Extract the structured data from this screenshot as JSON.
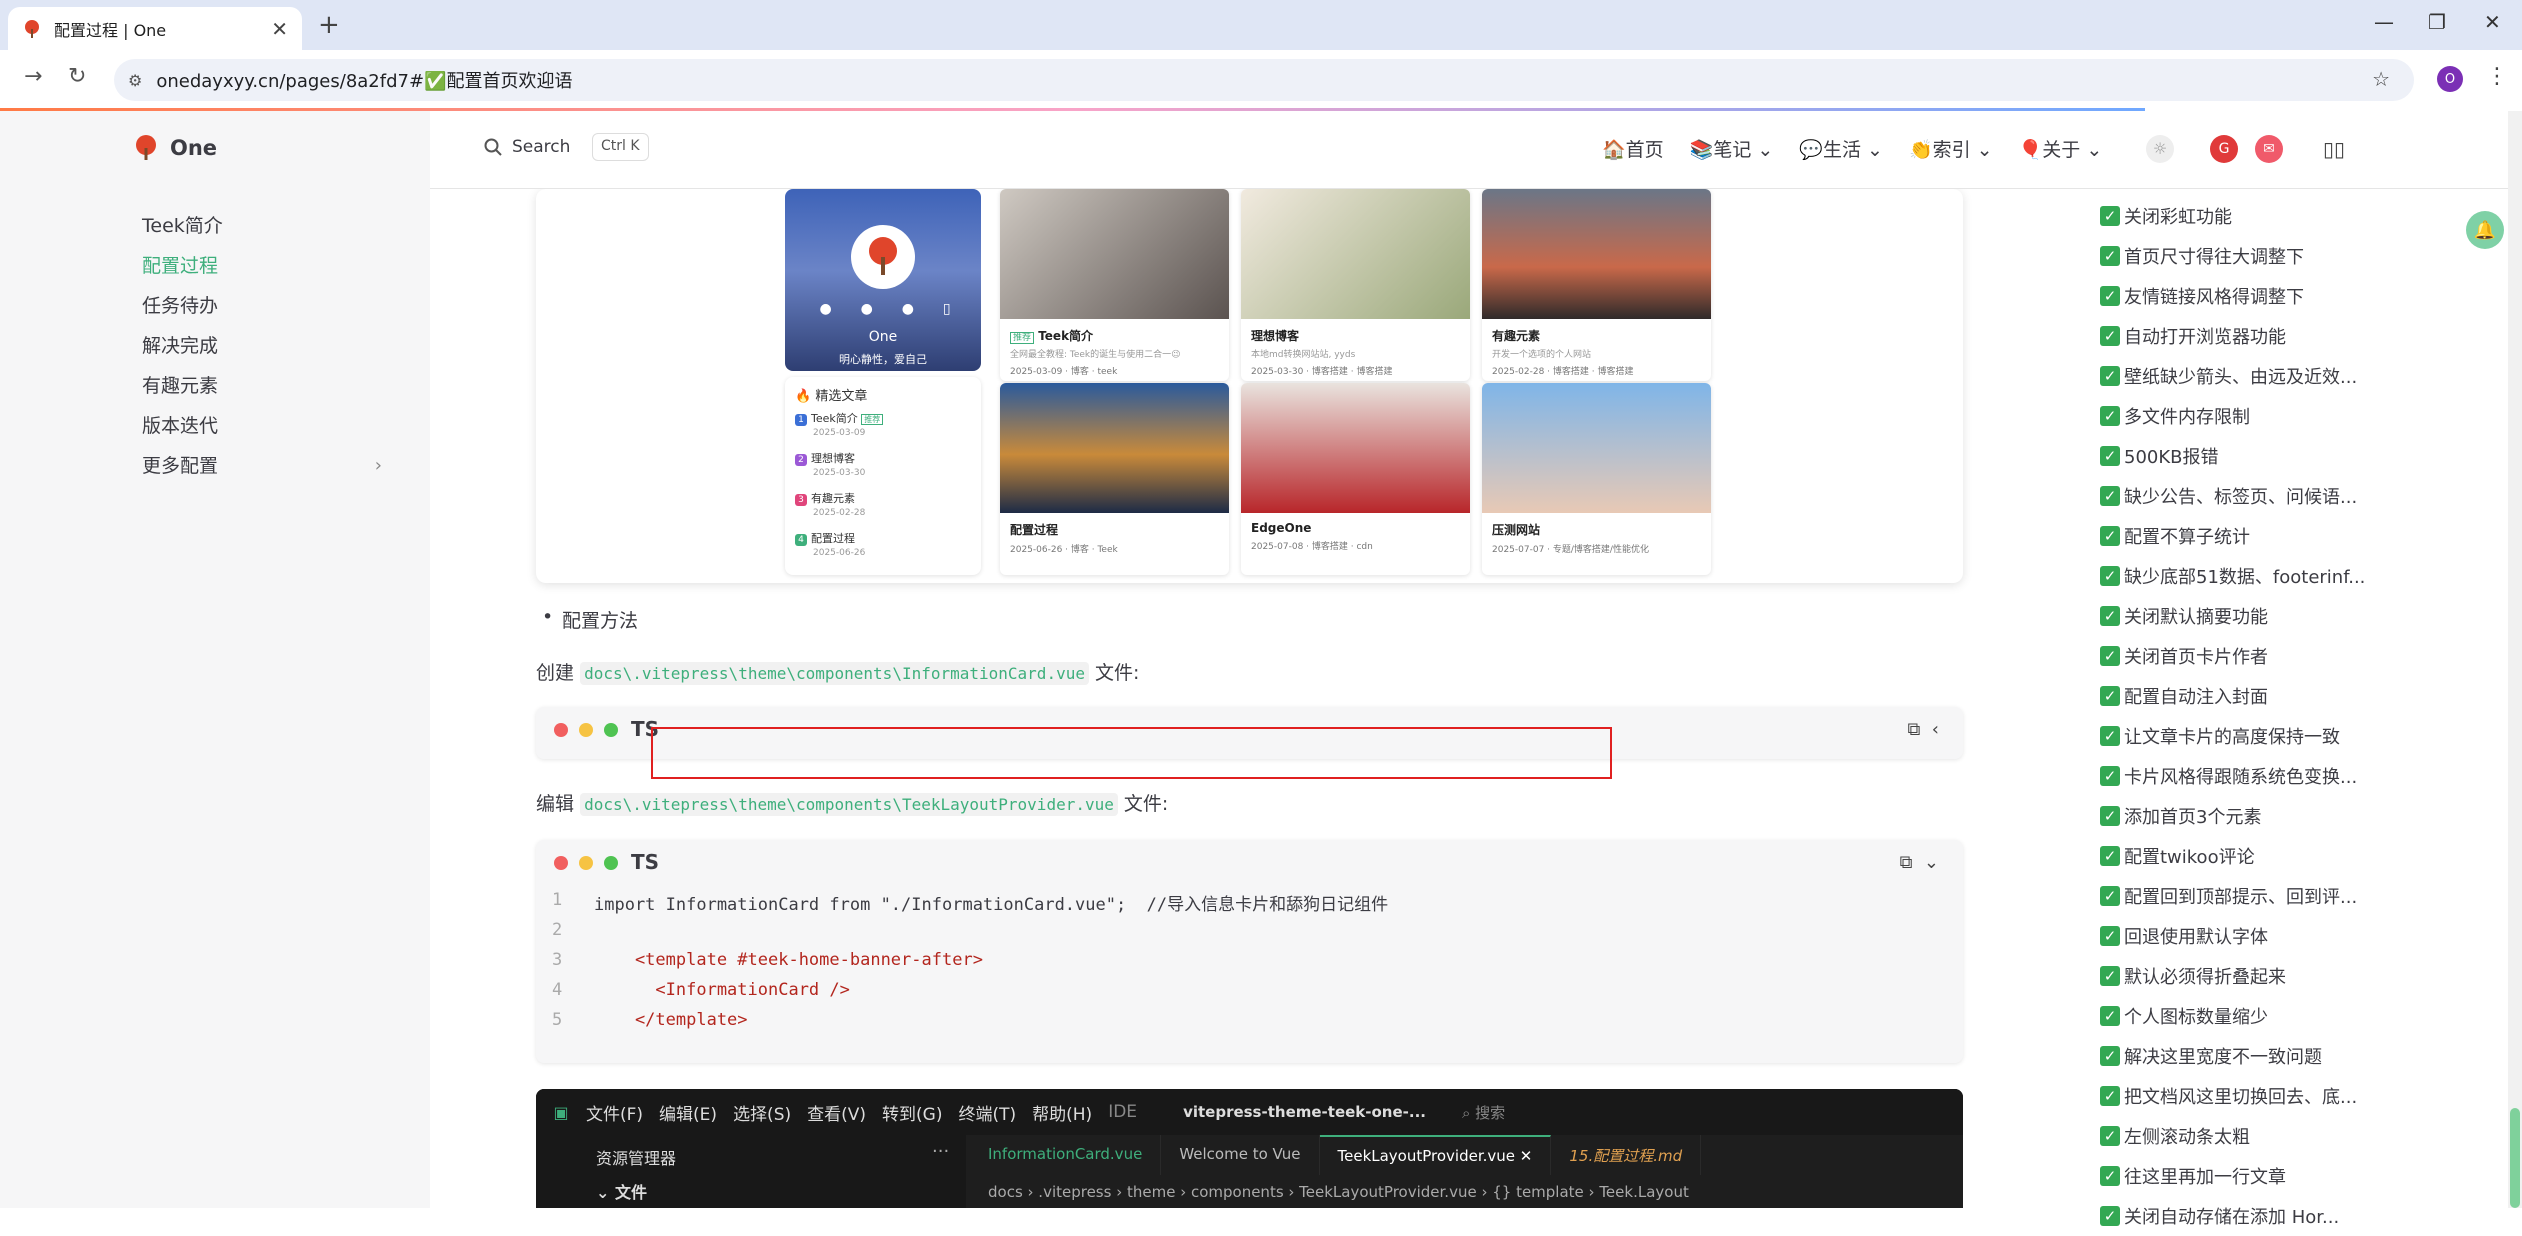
{
  "browser": {
    "tab_title": "配置过程 | One",
    "url": "onedayxyy.cn/pages/8a2fd7#✅配置首页欢迎语",
    "profile_initial": "O"
  },
  "sidebar": {
    "logo_text": "One",
    "items": [
      {
        "label": "Teek简介",
        "active": false
      },
      {
        "label": "配置过程",
        "active": true
      },
      {
        "label": "任务待办",
        "active": false
      },
      {
        "label": "解决完成",
        "active": false
      },
      {
        "label": "有趣元素",
        "active": false
      },
      {
        "label": "版本迭代",
        "active": false
      },
      {
        "label": "更多配置",
        "active": false
      }
    ]
  },
  "topnav": {
    "search_label": "Search",
    "shortcut": "Ctrl K",
    "links": [
      "🏠首页",
      "📚笔记",
      "💬生活",
      "👏索引",
      "🎈关于"
    ]
  },
  "hero": {
    "profile_name": "One",
    "profile_motto": "明心静性，爱自己",
    "featured_header": "🔥 精选文章",
    "featured": [
      {
        "n": "1",
        "title": "Teek简介",
        "tag": "推荐",
        "date": "2025-03-09",
        "color": "#3b6fd6"
      },
      {
        "n": "2",
        "title": "理想博客",
        "date": "2025-03-30",
        "color": "#9b59d6"
      },
      {
        "n": "3",
        "title": "有趣元素",
        "date": "2025-02-28",
        "color": "#e0457b"
      },
      {
        "n": "4",
        "title": "配置过程",
        "date": "2025-06-26",
        "color": "#3eaf7c"
      }
    ],
    "cards": [
      {
        "title": "Teek简介",
        "tag": "推荐",
        "desc": "全网最全教程: Teek的诞生与使用二合一😉",
        "meta": "2025-03-09 · 博客 · teek"
      },
      {
        "title": "理想博客",
        "desc": "本地md转换网站站, yyds",
        "meta": "2025-03-30 · 博客搭建 · 博客搭建"
      },
      {
        "title": "有趣元素",
        "desc": "开发一个选项的个人网站",
        "meta": "2025-02-28 · 博客搭建 · 博客搭建"
      },
      {
        "title": "配置过程",
        "meta": "2025-06-26 · 博客 · Teek"
      },
      {
        "title": "EdgeOne",
        "meta": "2025-07-08 · 博客搭建 · cdn"
      },
      {
        "title": "压测网站",
        "meta": "2025-07-07 · 专题/博客搭建/性能优化"
      }
    ]
  },
  "main": {
    "bullet": "配置方法",
    "create_prefix": "创建",
    "create_path": "docs\\.vitepress\\theme\\components\\InformationCard.vue",
    "create_suffix": "文件:",
    "edit_prefix": "编辑",
    "edit_path": "docs\\.vitepress\\theme\\components\\TeekLayoutProvider.vue",
    "edit_suffix": "文件:",
    "lang1": "TS",
    "lang2": "TS",
    "code": [
      {
        "n": "1",
        "text": "import InformationCard from \"./InformationCard.vue\";  //导入信息卡片和舔狗日记组件"
      },
      {
        "n": "2",
        "text": ""
      },
      {
        "n": "3",
        "text": "    <template #teek-home-banner-after>"
      },
      {
        "n": "4",
        "text": "      <InformationCard />"
      },
      {
        "n": "5",
        "text": "    </template>"
      }
    ]
  },
  "ide": {
    "menu": [
      "文件(F)",
      "编辑(E)",
      "选择(S)",
      "查看(V)",
      "转到(G)",
      "终端(T)",
      "帮助(H)"
    ],
    "ide_label": "IDE",
    "project": "vitepress-theme-teek-one-...",
    "search": "搜索",
    "explorer": "资源管理器",
    "folder": "文件",
    "tabs": [
      "InformationCard.vue",
      "Welcome to Vue",
      "TeekLayoutProvider.vue",
      "15.配置过程.md"
    ],
    "breadcrumb": "docs  ›  .vitepress  ›  theme  ›  components  ›  TeekLayoutProvider.vue  ›  {} template  ›  Teek.Layout"
  },
  "toc": [
    "关闭彩虹功能",
    "首页尺寸得往大调整下",
    "友情链接风格得调整下",
    "自动打开浏览器功能",
    "壁纸缺少箭头、由远及近效...",
    "多文件内存限制",
    "500KB报错",
    "缺少公告、标签页、问候语...",
    "配置不算子统计",
    "缺少底部51数据、footerinf...",
    "关闭默认摘要功能",
    "关闭首页卡片作者",
    "配置自动注入封面",
    "让文章卡片的高度保持一致",
    "卡片风格得跟随系统色变换...",
    "添加首页3个元素",
    "配置twikoo评论",
    "配置回到顶部提示、回到评...",
    "回退使用默认字体",
    "默认必须得折叠起来",
    "个人图标数量缩少",
    "解决这里宽度不一致问题",
    "把文档风这里切换回去、底...",
    "左侧滚动条太粗",
    "往这里再加一行文章",
    "关闭自动存储在添加 Hor..."
  ],
  "colors": {
    "accent": "#3eaf7c",
    "check": "#33a853",
    "red": "#e02020"
  }
}
